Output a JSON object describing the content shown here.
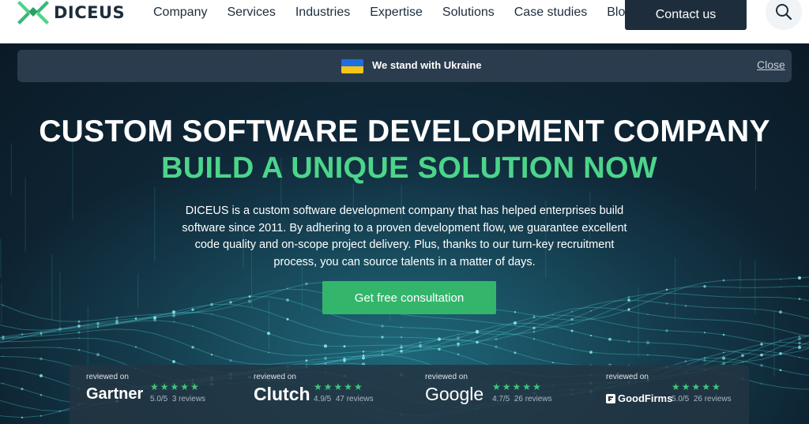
{
  "header": {
    "logo_text": "DICEUS",
    "nav": [
      "Company",
      "Services",
      "Industries",
      "Expertise",
      "Solutions",
      "Case studies",
      "Blog"
    ],
    "contact_label": "Contact us"
  },
  "banner": {
    "text": "We stand with Ukraine",
    "close_label": "Close"
  },
  "hero": {
    "title": "CUSTOM SOFTWARE DEVELOPMENT COMPANY",
    "subtitle": "BUILD A UNIQUE SOLUTION NOW",
    "description": "DICEUS is a custom software development company that has helped enterprises build software since 2011. By adhering to a proven development flow, we guarantee excellent code quality and on-scope project delivery. Plus, thanks to our turn-key recruitment process, you can source talents in a matter of days.",
    "cta_label": "Get free consultation"
  },
  "reviews": [
    {
      "reviewed_on": "reviewed on",
      "brand": "Gartner",
      "stars": "★★★★★",
      "score": "5.0/5",
      "count": "3 reviews"
    },
    {
      "reviewed_on": "reviewed on",
      "brand": "Clutch",
      "stars": "★★★★★",
      "score": "4.9/5",
      "count": "47 reviews"
    },
    {
      "reviewed_on": "reviewed on",
      "brand": "Google",
      "stars": "★★★★★",
      "score": "4.7/5",
      "count": "26 reviews"
    },
    {
      "reviewed_on": "reviewed on",
      "brand": "GoodFirms",
      "stars": "★★★★★",
      "score": "5.0/5",
      "count": "26 reviews"
    }
  ],
  "colors": {
    "brand_dark": "#1d2d3c",
    "accent_green": "#4cd58a",
    "cta_green": "#34b56c",
    "star_green": "#3ec77b",
    "flag_blue": "#1e6ee0",
    "flag_yellow": "#f5c518"
  },
  "icons": {
    "logo": "diceus-logo-icon",
    "search": "search-icon",
    "flag": "ukraine-flag-icon",
    "goodfirms": "goodfirms-logo-icon"
  }
}
